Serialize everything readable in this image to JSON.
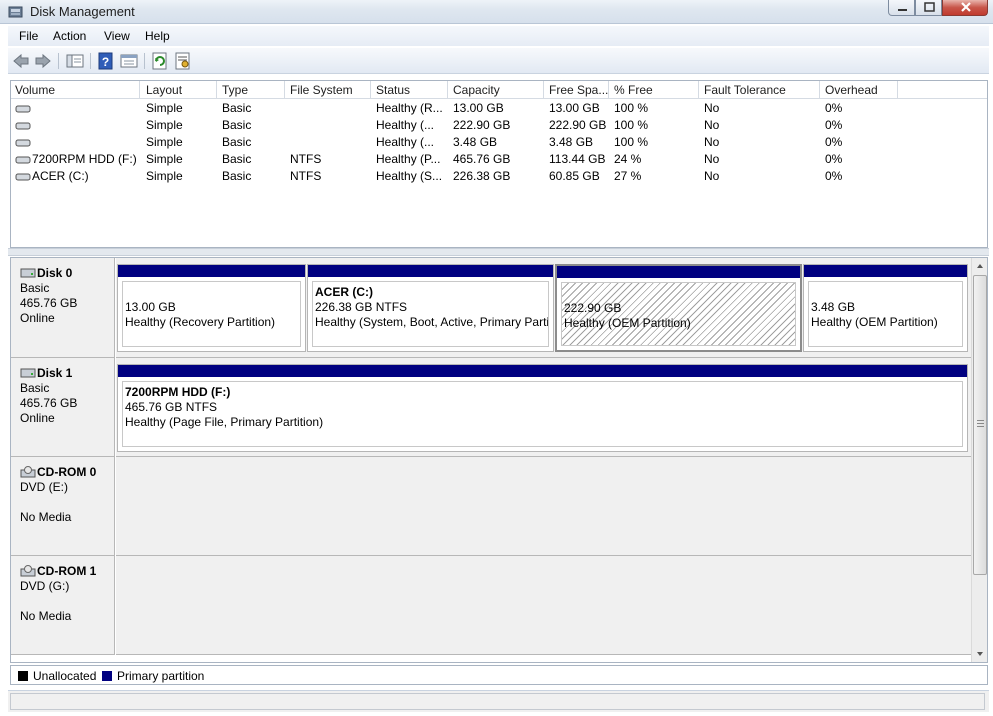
{
  "window": {
    "title": "Disk Management"
  },
  "menu": {
    "items": [
      "File",
      "Action",
      "View",
      "Help"
    ]
  },
  "toolbar": {
    "buttons": [
      "back-arrow-icon",
      "forward-arrow-icon",
      "console-tree-icon",
      "help-icon",
      "properties-icon",
      "refresh-icon",
      "rescan-disks-icon"
    ]
  },
  "list": {
    "columns": [
      "Volume",
      "Layout",
      "Type",
      "File System",
      "Status",
      "Capacity",
      "Free Spa...",
      "% Free",
      "Fault Tolerance",
      "Overhead"
    ],
    "rows": [
      [
        "",
        "Simple",
        "Basic",
        "",
        "Healthy (R...",
        "13.00 GB",
        "13.00 GB",
        "100 %",
        "No",
        "0%"
      ],
      [
        "",
        "Simple",
        "Basic",
        "",
        "Healthy (...",
        "222.90 GB",
        "222.90 GB",
        "100 %",
        "No",
        "0%"
      ],
      [
        "",
        "Simple",
        "Basic",
        "",
        "Healthy (...",
        "3.48 GB",
        "3.48 GB",
        "100 %",
        "No",
        "0%"
      ],
      [
        "7200RPM HDD (F:)",
        "Simple",
        "Basic",
        "NTFS",
        "Healthy (P...",
        "465.76 GB",
        "113.44 GB",
        "24 %",
        "No",
        "0%"
      ],
      [
        "ACER (C:)",
        "Simple",
        "Basic",
        "NTFS",
        "Healthy (S...",
        "226.38 GB",
        "60.85 GB",
        "27 %",
        "No",
        "0%"
      ]
    ]
  },
  "disks": [
    {
      "name": "Disk 0",
      "type": "Basic",
      "size": "465.76 GB",
      "state": "Online",
      "partitions": [
        {
          "name": "",
          "size": "13.00 GB",
          "status": "Healthy (Recovery Partition)"
        },
        {
          "name": "ACER  (C:)",
          "size": "226.38 GB NTFS",
          "status": "Healthy (System, Boot, Active, Primary Partition)"
        },
        {
          "name": "",
          "size": "222.90 GB",
          "status": "Healthy (OEM Partition)"
        },
        {
          "name": "",
          "size": "3.48 GB",
          "status": "Healthy (OEM Partition)"
        }
      ]
    },
    {
      "name": "Disk 1",
      "type": "Basic",
      "size": "465.76 GB",
      "state": "Online",
      "partitions": [
        {
          "name": "7200RPM HDD  (F:)",
          "size": "465.76 GB NTFS",
          "status": "Healthy (Page File, Primary Partition)"
        }
      ]
    },
    {
      "name": "CD-ROM 0",
      "type": "DVD (E:)",
      "size": "",
      "state": "No Media",
      "partitions": []
    },
    {
      "name": "CD-ROM 1",
      "type": "DVD (G:)",
      "size": "",
      "state": "No Media",
      "partitions": []
    }
  ],
  "legend": {
    "items": [
      {
        "label": "Unallocated",
        "color": "#000000"
      },
      {
        "label": "Primary partition",
        "color": "#000080"
      }
    ]
  },
  "colors": {
    "partition_bar": "#000080",
    "close_button": "#c8564a"
  }
}
